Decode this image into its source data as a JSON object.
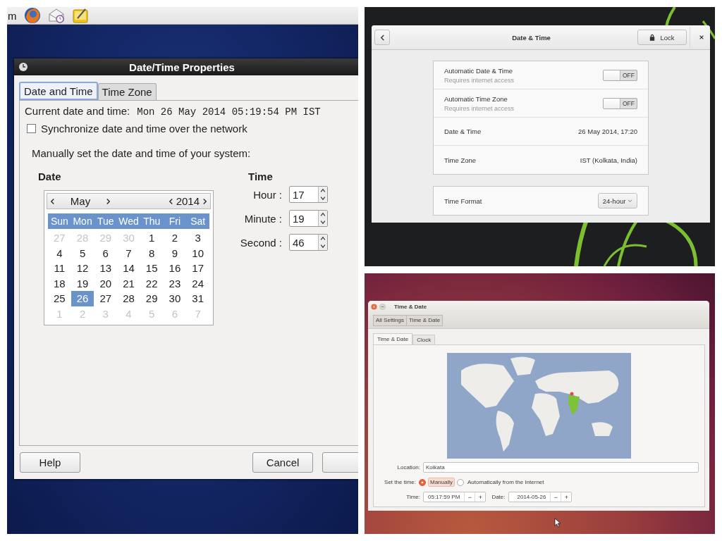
{
  "fedora_screen": {
    "top_panel": {
      "menu_text": "m"
    },
    "dialog": {
      "title": "Date/Time Properties",
      "tabs": [
        {
          "label": "Date and Time",
          "selected": true
        },
        {
          "label": "Time Zone",
          "selected": false
        }
      ],
      "current_label": "Current date and time:",
      "current_value": "Mon 26 May 2014 05:19:54 PM IST",
      "sync": {
        "label": "Synchronize date and time over the network",
        "checked": false
      },
      "manual_heading": "Manually set the date and time of your system:",
      "date_heading": "Date",
      "time_heading": "Time",
      "calendar": {
        "month": "May",
        "year": "2014",
        "weekdays": [
          "Sun",
          "Mon",
          "Tue",
          "Wed",
          "Thu",
          "Fri",
          "Sat"
        ],
        "weeks": [
          [
            {
              "text": "27",
              "muted": true,
              "selected": false
            },
            {
              "text": "28",
              "muted": true,
              "selected": false
            },
            {
              "text": "29",
              "muted": true,
              "selected": false
            },
            {
              "text": "30",
              "muted": true,
              "selected": false
            },
            {
              "text": "1",
              "muted": false,
              "selected": false
            },
            {
              "text": "2",
              "muted": false,
              "selected": false
            },
            {
              "text": "3",
              "muted": false,
              "selected": false
            }
          ],
          [
            {
              "text": "4",
              "muted": false,
              "selected": false
            },
            {
              "text": "5",
              "muted": false,
              "selected": false
            },
            {
              "text": "6",
              "muted": false,
              "selected": false
            },
            {
              "text": "7",
              "muted": false,
              "selected": false
            },
            {
              "text": "8",
              "muted": false,
              "selected": false
            },
            {
              "text": "9",
              "muted": false,
              "selected": false
            },
            {
              "text": "10",
              "muted": false,
              "selected": false
            }
          ],
          [
            {
              "text": "11",
              "muted": false,
              "selected": false
            },
            {
              "text": "12",
              "muted": false,
              "selected": false
            },
            {
              "text": "13",
              "muted": false,
              "selected": false
            },
            {
              "text": "14",
              "muted": false,
              "selected": false
            },
            {
              "text": "15",
              "muted": false,
              "selected": false
            },
            {
              "text": "16",
              "muted": false,
              "selected": false
            },
            {
              "text": "17",
              "muted": false,
              "selected": false
            }
          ],
          [
            {
              "text": "18",
              "muted": false,
              "selected": false
            },
            {
              "text": "19",
              "muted": false,
              "selected": false
            },
            {
              "text": "20",
              "muted": false,
              "selected": false
            },
            {
              "text": "21",
              "muted": false,
              "selected": false
            },
            {
              "text": "22",
              "muted": false,
              "selected": false
            },
            {
              "text": "23",
              "muted": false,
              "selected": false
            },
            {
              "text": "24",
              "muted": false,
              "selected": false
            }
          ],
          [
            {
              "text": "25",
              "muted": false,
              "selected": false
            },
            {
              "text": "26",
              "muted": false,
              "selected": true
            },
            {
              "text": "27",
              "muted": false,
              "selected": false
            },
            {
              "text": "28",
              "muted": false,
              "selected": false
            },
            {
              "text": "29",
              "muted": false,
              "selected": false
            },
            {
              "text": "30",
              "muted": false,
              "selected": false
            },
            {
              "text": "31",
              "muted": false,
              "selected": false
            }
          ],
          [
            {
              "text": "1",
              "muted": true,
              "selected": false
            },
            {
              "text": "2",
              "muted": true,
              "selected": false
            },
            {
              "text": "3",
              "muted": true,
              "selected": false
            },
            {
              "text": "4",
              "muted": true,
              "selected": false
            },
            {
              "text": "5",
              "muted": true,
              "selected": false
            },
            {
              "text": "6",
              "muted": true,
              "selected": false
            },
            {
              "text": "7",
              "muted": true,
              "selected": false
            }
          ]
        ]
      },
      "spinners": [
        {
          "label": "Hour :",
          "value": "17"
        },
        {
          "label": "Minute :",
          "value": "19"
        },
        {
          "label": "Second :",
          "value": "46"
        }
      ],
      "buttons": [
        "Help",
        "Cancel"
      ]
    }
  },
  "gnome_screen": {
    "window": {
      "title": "Date & Time",
      "lock": "Lock",
      "rows": [
        {
          "kind": "switch",
          "title": "Automatic Date & Time",
          "subtitle": "Requires internet access",
          "on": false,
          "state_label": "OFF"
        },
        {
          "kind": "switch",
          "title": "Automatic Time Zone",
          "subtitle": "Requires internet access",
          "on": false,
          "state_label": "OFF"
        },
        {
          "kind": "value",
          "title": "Date & Time",
          "value": "26 May 2014, 17:20"
        },
        {
          "kind": "value",
          "title": "Time Zone",
          "value": "IST (Kolkata, India)"
        }
      ],
      "format": {
        "label": "Time Format",
        "value": "24-hour"
      }
    }
  },
  "ubuntu_screen": {
    "window": {
      "title": "Time & Date",
      "breadcrumbs": [
        "All Settings",
        "Time & Date"
      ],
      "tabs": [
        {
          "label": "Time & Date",
          "selected": true
        },
        {
          "label": "Clock",
          "selected": false
        }
      ],
      "location": {
        "label": "Location:",
        "value": "Kolkata"
      },
      "set_time": {
        "label": "Set the time:",
        "options": [
          {
            "label": "Manually",
            "selected": true
          },
          {
            "label": "Automatically from the Internet",
            "selected": false
          }
        ]
      },
      "steppers": [
        {
          "label": "Time:",
          "value": "05:17:59 PM",
          "buttons": [
            "−",
            "+"
          ]
        },
        {
          "label": "Date:",
          "value": "2014-05-26",
          "buttons": [
            "−",
            "+"
          ]
        }
      ]
    }
  }
}
